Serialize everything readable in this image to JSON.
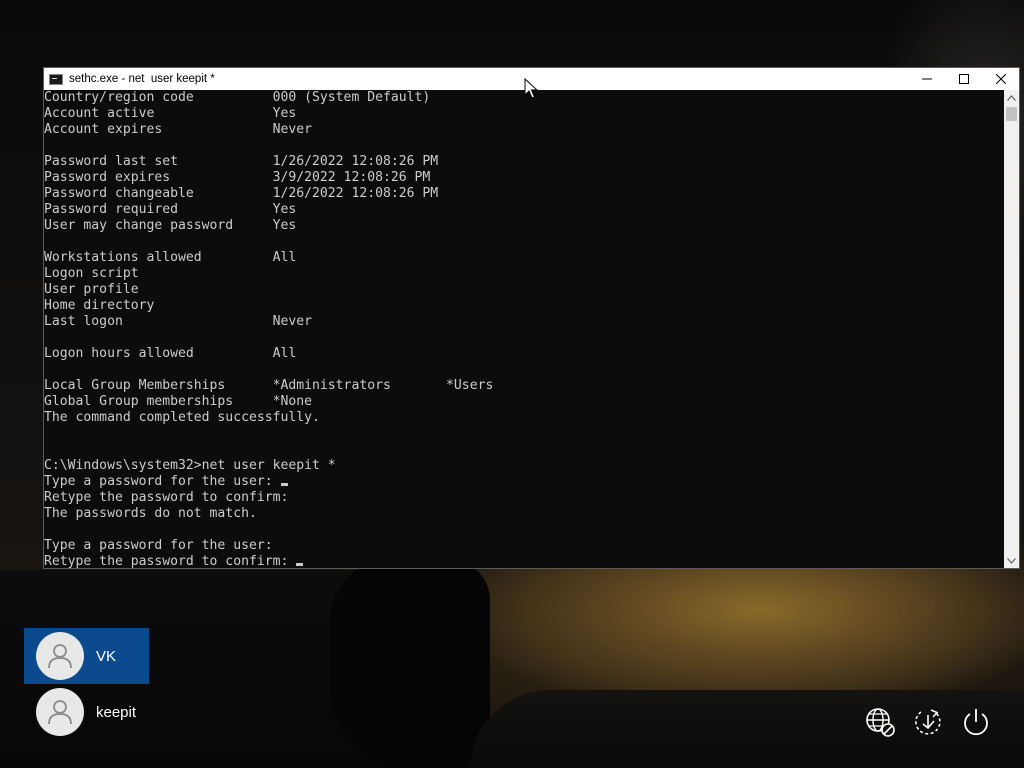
{
  "console": {
    "title": "sethc.exe - net  user keepit *",
    "lines": [
      "Country/region code          000 (System Default)",
      "Account active               Yes",
      "Account expires              Never",
      "",
      "Password last set            1/26/2022 12:08:26 PM",
      "Password expires             3/9/2022 12:08:26 PM",
      "Password changeable          1/26/2022 12:08:26 PM",
      "Password required            Yes",
      "User may change password     Yes",
      "",
      "Workstations allowed         All",
      "Logon script",
      "User profile",
      "Home directory",
      "Last logon                   Never",
      "",
      "Logon hours allowed          All",
      "",
      "Local Group Memberships      *Administrators       *Users",
      "Global Group memberships     *None",
      "The command completed successfully.",
      "",
      "",
      "C:\\Windows\\system32>net user keepit *",
      "Type a password for the user: ",
      "Retype the password to confirm:",
      "The passwords do not match.",
      "",
      "Type a password for the user:",
      "Retype the password to confirm: "
    ],
    "cursor_lines": [
      24,
      29
    ]
  },
  "users": [
    {
      "name": "VK",
      "selected": true
    },
    {
      "name": "keepit",
      "selected": false
    }
  ],
  "system_icons": [
    "network-icon",
    "accessibility-icon",
    "power-icon"
  ],
  "colors": {
    "console_bg": "#0c0c0c",
    "console_text": "#cccccc",
    "selected_user": "#0b4a8e"
  }
}
